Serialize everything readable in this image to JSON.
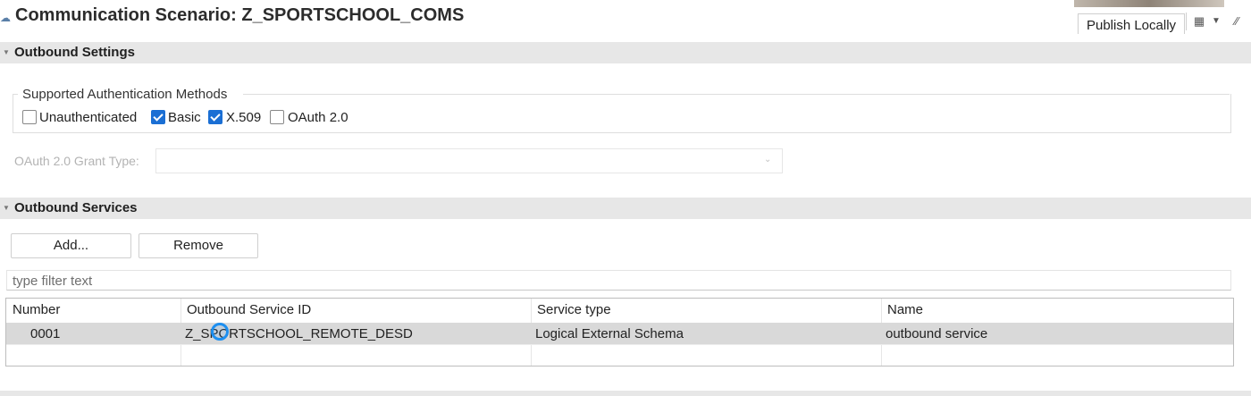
{
  "header": {
    "title": "Communication Scenario: Z_SPORTSCHOOL_COMS",
    "publish_label": "Publish Locally"
  },
  "outbound_settings": {
    "section_title": "Outbound Settings",
    "auth_group_label": "Supported Authentication Methods",
    "methods": [
      {
        "label": "Unauthenticated",
        "checked": false
      },
      {
        "label": "Basic",
        "checked": true
      },
      {
        "label": "X.509",
        "checked": true
      },
      {
        "label": "OAuth 2.0",
        "checked": false
      }
    ],
    "grant_type_label": "OAuth 2.0 Grant Type:",
    "grant_type_value": ""
  },
  "outbound_services": {
    "section_title": "Outbound Services",
    "add_label": "Add...",
    "remove_label": "Remove",
    "filter_placeholder": "type filter text",
    "columns": [
      "Number",
      "Outbound Service ID",
      "Service type",
      "Name"
    ],
    "rows": [
      {
        "number": "0001",
        "service_id": "Z_SPORTSCHOOL_REMOTE_DESD",
        "service_type": "Logical External Schema",
        "name": "outbound service"
      }
    ]
  },
  "colors": {
    "accent": "#1b6fd4",
    "section_bg": "#e7e7e7",
    "selected_row": "#d9d9d9"
  }
}
